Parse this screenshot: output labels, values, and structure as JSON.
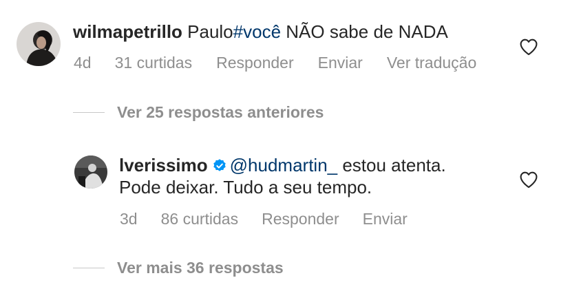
{
  "comment1": {
    "username": "wilmapetrillo",
    "text_before": " Paulo",
    "hashtag": "#você",
    "text_after": " NÃO sabe de NADA",
    "time": "4d",
    "likes": "31 curtidas",
    "reply": "Responder",
    "send": "Enviar",
    "translate": "Ver tradução"
  },
  "view_previous": "Ver 25 respostas anteriores",
  "comment2": {
    "username": "lverissimo",
    "mention": "@hudmartin_",
    "text_line1": " estou atenta.",
    "text_line2": "Pode deixar. Tudo a seu tempo.",
    "time": "3d",
    "likes": "86 curtidas",
    "reply": "Responder",
    "send": "Enviar"
  },
  "view_more": "Ver mais 36 respostas",
  "colors": {
    "text": "#262626",
    "secondary": "#8e8e8e",
    "link": "#00376b",
    "verified": "#0095f6"
  },
  "icons": {
    "like": "heart-outline-icon",
    "verified": "verified-badge-icon"
  }
}
